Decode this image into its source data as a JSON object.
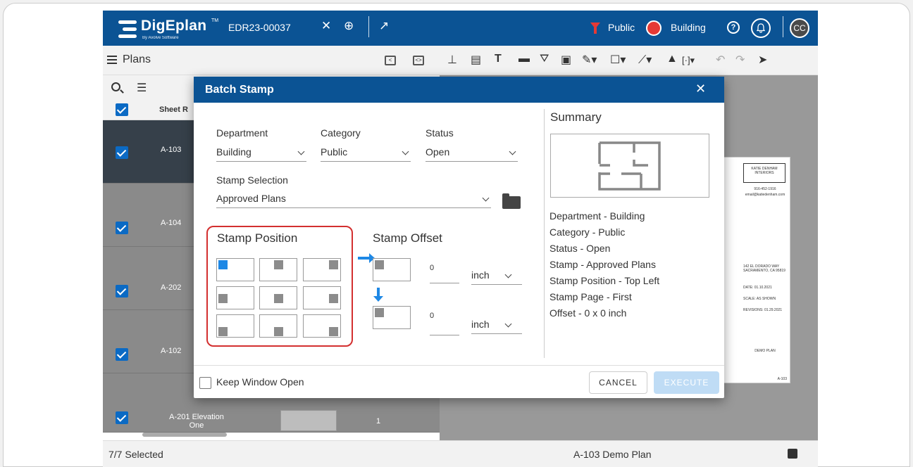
{
  "topbar": {
    "logo": "DigEplan",
    "logo_tm": "TM",
    "logo_sub": "By Avolve Software",
    "project": "EDR23-00037",
    "close_icon": "✕",
    "add_icon": "⊕",
    "open_icon": "↗",
    "filter_label": "Public",
    "status_label": "Building",
    "help_icon": "?",
    "bell_icon": "🔔",
    "avatar": "CC",
    "colors": {
      "bar": "#0b5394",
      "status_dot": "#e53935"
    }
  },
  "plans_panel": {
    "title": "Plans",
    "collapse_icon": "<",
    "expand_icon": "<>",
    "column_header": "Sheet R",
    "rows": [
      {
        "label": "A-103"
      },
      {
        "label": "A-104"
      },
      {
        "label": "A-202"
      },
      {
        "label": "A-102"
      },
      {
        "label_line1": "A-201 Elevation",
        "label_line2": "One",
        "num": "1"
      }
    ],
    "footer": "7/7 Selected"
  },
  "viewer": {
    "footer": "A-103 Demo Plan",
    "tools": [
      "⊥",
      "▤",
      "T",
      "▬",
      "⛛",
      "▣",
      "✎▾",
      "☐▾",
      "⟋▾",
      "▲",
      "[·]▾",
      "↶",
      "↷",
      "➤"
    ],
    "sheet": {
      "firm": "KATIE DENHAM INTERIORS",
      "phone": "916-452-1916",
      "email": "email@katiedenham.com",
      "address": "142 EL DORADO WAY SACRAMENTO, CA 95819",
      "date": "DATE: 01.10.2021",
      "scale": "SCALE: AS SHOWN",
      "revisions": "REVISIONS: 01.29.2021",
      "plan_name": "DEMO PLAN",
      "sheet_no": "A-103"
    }
  },
  "dialog": {
    "title": "Batch Stamp",
    "close": "✕",
    "department": {
      "label": "Department",
      "value": "Building"
    },
    "category": {
      "label": "Category",
      "value": "Public"
    },
    "status": {
      "label": "Status",
      "value": "Open"
    },
    "stamp_selection": {
      "label": "Stamp Selection",
      "value": "Approved Plans"
    },
    "stamp_position": {
      "label": "Stamp Position",
      "selected": "Top Left"
    },
    "stamp_offset": {
      "label": "Stamp Offset",
      "x": {
        "value": "0",
        "unit": "inch"
      },
      "y": {
        "value": "0",
        "unit": "inch"
      }
    },
    "summary": {
      "title": "Summary",
      "lines": [
        "Department - Building",
        "Category - Public",
        "Status - Open",
        "Stamp - Approved Plans",
        "Stamp Position - Top Left",
        "Stamp Page - First",
        "Offset - 0 x 0 inch"
      ]
    },
    "keep_open": "Keep Window Open",
    "cancel": "CANCEL",
    "execute": "EXECUTE",
    "colors": {
      "header": "#0b5394",
      "highlight": "#d32f2f",
      "accent": "#1e88e5"
    }
  }
}
